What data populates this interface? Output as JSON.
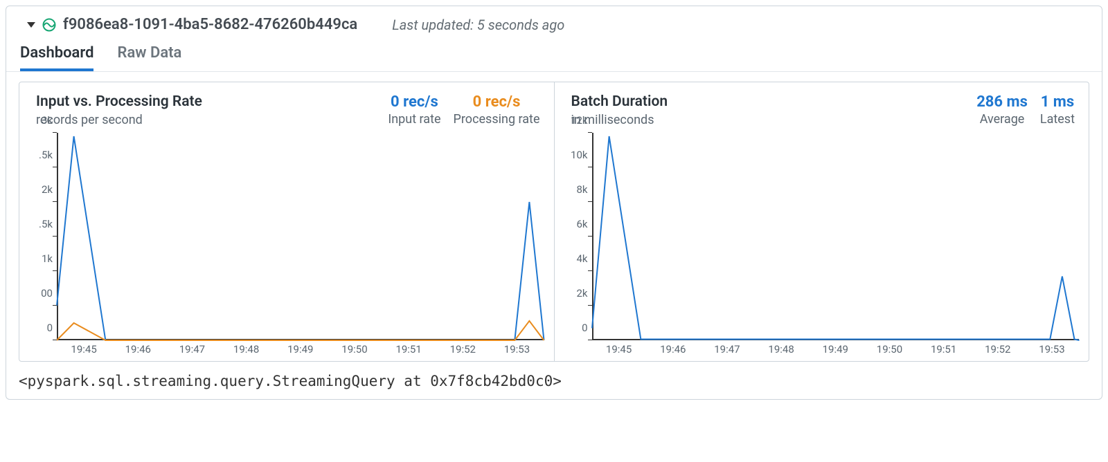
{
  "header": {
    "title": "f9086ea8-1091-4ba5-8682-476260b449ca",
    "updated_label": "Last updated: 5 seconds ago"
  },
  "tabs": {
    "dashboard": "Dashboard",
    "raw_data": "Raw Data"
  },
  "footer_code": "<pyspark.sql.streaming.query.StreamingQuery at 0x7f8cb42bd0c0>",
  "colors": {
    "blue": "#1f77d0",
    "orange": "#e98c1e"
  },
  "chart_data": [
    {
      "id": "rate",
      "type": "line",
      "title": "Input vs. Processing Rate",
      "subtitle": "records per second",
      "metrics": [
        {
          "value": "0 rec/s",
          "label": "Input rate",
          "color": "blue"
        },
        {
          "value": "0 rec/s",
          "label": "Processing rate",
          "color": "orange"
        }
      ],
      "xlabel": "",
      "ylabel": "",
      "ylim": [
        0,
        3000
      ],
      "y_ticks": [
        {
          "v": 0,
          "label": "0"
        },
        {
          "v": 500,
          "label": "00"
        },
        {
          "v": 1000,
          "label": "1k"
        },
        {
          "v": 1500,
          "label": ".5k"
        },
        {
          "v": 2000,
          "label": "2k"
        },
        {
          "v": 2500,
          "label": ".5k"
        },
        {
          "v": 3000,
          "label": "3k"
        }
      ],
      "x_ticks": [
        "19:45",
        "19:46",
        "19:47",
        "19:48",
        "19:49",
        "19:50",
        "19:51",
        "19:52",
        "19:53"
      ],
      "x": [
        0,
        0.035,
        0.1,
        0.94,
        0.97,
        1.0
      ],
      "series": [
        {
          "name": "Input rate",
          "color": "blue",
          "values": [
            500,
            2950,
            0,
            0,
            2000,
            0
          ]
        },
        {
          "name": "Processing rate",
          "color": "orange",
          "values": [
            0,
            250,
            0,
            0,
            280,
            0
          ]
        }
      ]
    },
    {
      "id": "duration",
      "type": "line",
      "title": "Batch Duration",
      "subtitle": "in milliseconds",
      "metrics": [
        {
          "value": "286 ms",
          "label": "Average",
          "color": "blue"
        },
        {
          "value": "1 ms",
          "label": "Latest",
          "color": "blue"
        }
      ],
      "xlabel": "",
      "ylabel": "",
      "ylim": [
        0,
        12000
      ],
      "y_ticks": [
        {
          "v": 0,
          "label": "0"
        },
        {
          "v": 2000,
          "label": "2k"
        },
        {
          "v": 4000,
          "label": "4k"
        },
        {
          "v": 6000,
          "label": "6k"
        },
        {
          "v": 8000,
          "label": "8k"
        },
        {
          "v": 10000,
          "label": "10k"
        },
        {
          "v": 12000,
          "label": "12k"
        }
      ],
      "x_ticks": [
        "19:45",
        "19:46",
        "19:47",
        "19:48",
        "19:49",
        "19:50",
        "19:51",
        "19:52",
        "19:53"
      ],
      "x": [
        0,
        0.035,
        0.1,
        0.94,
        0.965,
        0.99,
        1.0
      ],
      "series": [
        {
          "name": "Batch duration",
          "color": "blue",
          "values": [
            700,
            11800,
            60,
            60,
            3700,
            60,
            1
          ]
        }
      ]
    }
  ]
}
